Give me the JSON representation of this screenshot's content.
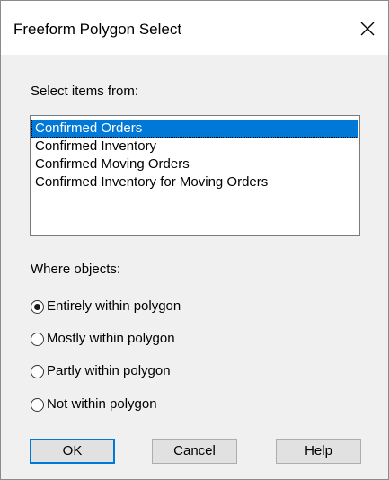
{
  "window": {
    "title": "Freeform Polygon Select"
  },
  "select_items": {
    "label": "Select items from:",
    "items": [
      {
        "label": "Confirmed Orders",
        "selected": true
      },
      {
        "label": "Confirmed Inventory",
        "selected": false
      },
      {
        "label": "Confirmed Moving Orders",
        "selected": false
      },
      {
        "label": "Confirmed Inventory for Moving Orders",
        "selected": false
      }
    ]
  },
  "where_objects": {
    "label": "Where objects:",
    "options": [
      {
        "label": "Entirely within polygon",
        "checked": true
      },
      {
        "label": "Mostly within polygon",
        "checked": false
      },
      {
        "label": "Partly within polygon",
        "checked": false
      },
      {
        "label": "Not within polygon",
        "checked": false
      }
    ]
  },
  "buttons": {
    "ok": "OK",
    "cancel": "Cancel",
    "help": "Help"
  },
  "colors": {
    "selection": "#0078d7",
    "default_button_border": "#0078d7",
    "dialog_background": "#f0f0f0"
  },
  "icons": {
    "close": "close-icon"
  }
}
